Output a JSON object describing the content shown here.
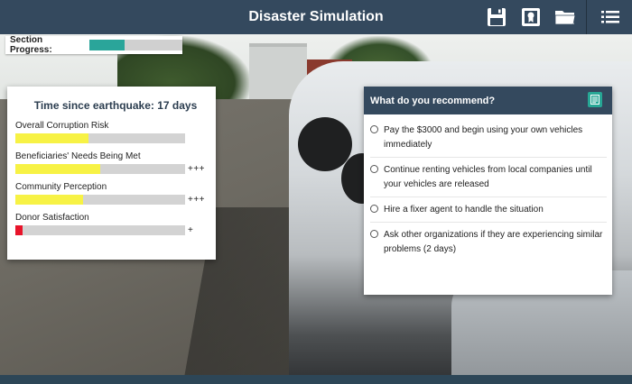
{
  "app": {
    "title": "Disaster Simulation",
    "header_icons": [
      "save-icon",
      "certificate-icon",
      "folder-icon",
      "menu-icon"
    ]
  },
  "section_progress": {
    "label": "Section Progress:",
    "value": 0.38,
    "color": "#2aa59a"
  },
  "stats": {
    "time_label": "Time since earthquake: 17 days",
    "items": [
      {
        "name": "Overall Corruption Risk",
        "value": 0.43,
        "color": "#f7f245",
        "delta": ""
      },
      {
        "name": "Beneficiaries' Needs Being Met",
        "value": 0.5,
        "color": "#f7f245",
        "delta": "+++"
      },
      {
        "name": "Community Perception",
        "value": 0.4,
        "color": "#f7f245",
        "delta": "+++"
      },
      {
        "name": "Donor Satisfaction",
        "value": 0.045,
        "color": "#e8142a",
        "delta": "+"
      }
    ]
  },
  "question": {
    "title": "What do you recommend?",
    "notes_icon": "notes-icon",
    "options": [
      {
        "text": "Pay the $3000 and begin using your own vehicles immediately"
      },
      {
        "text": "Continue renting vehicles from local companies until your vehicles are released"
      },
      {
        "text": "Hire a fixer agent to handle the situation"
      },
      {
        "text": "Ask other organizations if they are experiencing similar problems (2 days)"
      }
    ]
  },
  "colors": {
    "header": "#34495e",
    "accent": "#27a795"
  }
}
